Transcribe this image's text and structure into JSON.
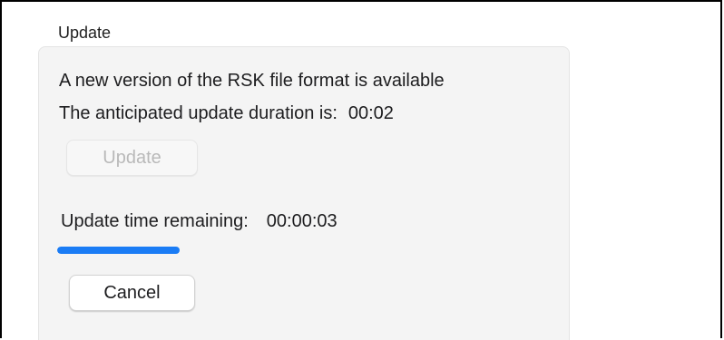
{
  "section": {
    "title": "Update"
  },
  "update_panel": {
    "message": "A new version of the RSK file format is available",
    "duration_label": "The anticipated update duration is:",
    "duration_value": "00:02",
    "update_button_label": "Update",
    "update_button_enabled": false,
    "remaining_label": "Update time remaining:",
    "remaining_value": "00:00:03",
    "progress_fraction": 0.48,
    "cancel_button_label": "Cancel"
  },
  "colors": {
    "progress_fill": "#1a7cf5",
    "panel_background": "#f4f4f4",
    "disabled_text": "#b9b9b9"
  }
}
